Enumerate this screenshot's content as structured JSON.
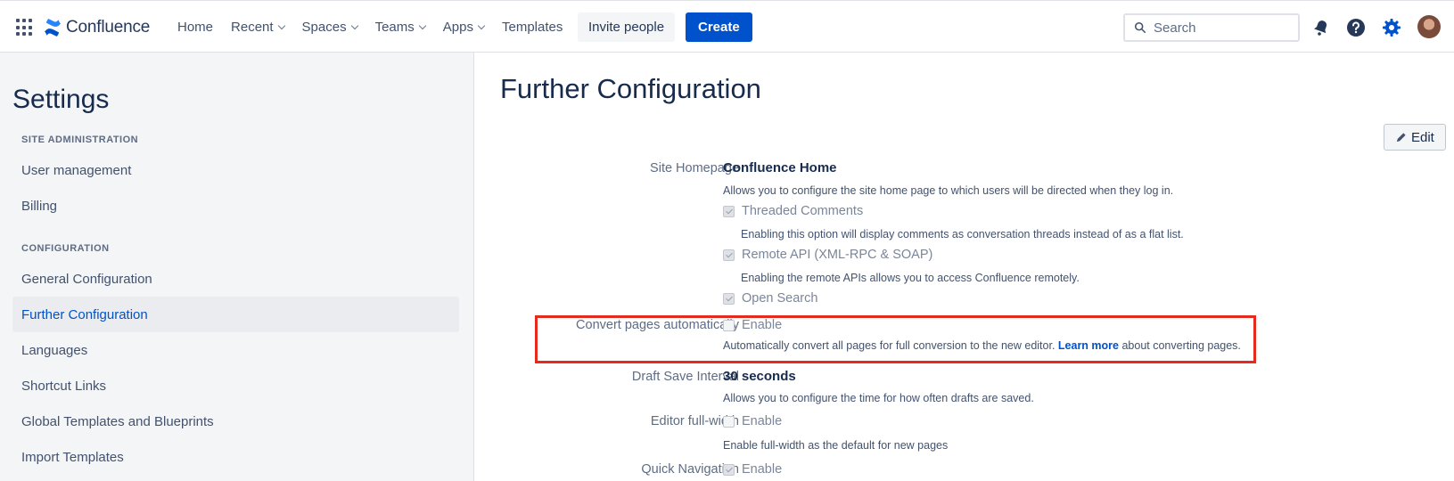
{
  "topnav": {
    "app_name": "Confluence",
    "items": [
      {
        "label": "Home",
        "dropdown": false
      },
      {
        "label": "Recent",
        "dropdown": true
      },
      {
        "label": "Spaces",
        "dropdown": true
      },
      {
        "label": "Teams",
        "dropdown": true
      },
      {
        "label": "Apps",
        "dropdown": true
      },
      {
        "label": "Templates",
        "dropdown": false
      }
    ],
    "invite_label": "Invite people",
    "create_label": "Create",
    "search_placeholder": "Search",
    "accent_color": "#0052cc"
  },
  "sidebar": {
    "title": "Settings",
    "section_site_admin": "SITE ADMINISTRATION",
    "section_configuration": "CONFIGURATION",
    "items": [
      {
        "label": "User management"
      },
      {
        "label": "Billing"
      },
      {
        "label": "General Configuration"
      },
      {
        "label": "Further Configuration",
        "active": true
      },
      {
        "label": "Languages"
      },
      {
        "label": "Shortcut Links"
      },
      {
        "label": "Global Templates and Blueprints"
      },
      {
        "label": "Import Templates"
      }
    ]
  },
  "main": {
    "title": "Further Configuration",
    "edit_label": "Edit",
    "site_homepage": {
      "label": "Site Homepage",
      "value": "Confluence Home",
      "desc": "Allows you to configure the site home page to which users will be directed when they log in."
    },
    "threaded_comments": {
      "label": "Threaded Comments",
      "checked": true,
      "desc": "Enabling this option will display comments as conversation threads instead of as a flat list."
    },
    "remote_api": {
      "label": "Remote API (XML-RPC & SOAP)",
      "checked": true,
      "desc": "Enabling the remote APIs allows you to access Confluence remotely."
    },
    "open_search": {
      "label": "Open Search",
      "checked": true
    },
    "convert_pages": {
      "label": "Convert pages automatically",
      "option": "Enable",
      "checked": false,
      "desc_before": "Automatically convert all pages for full conversion to the new editor. ",
      "link": "Learn more",
      "desc_after": " about converting pages."
    },
    "draft_save": {
      "label": "Draft Save Interval",
      "value": "30 seconds",
      "desc": "Allows you to configure the time for how often drafts are saved."
    },
    "editor_full_width": {
      "label": "Editor full-width",
      "option": "Enable",
      "checked": false,
      "desc": "Enable full-width as the default for new pages"
    },
    "quick_navigation": {
      "label": "Quick Navigation",
      "option": "Enable",
      "checked": true
    }
  },
  "highlight_color": "#e52a1e"
}
